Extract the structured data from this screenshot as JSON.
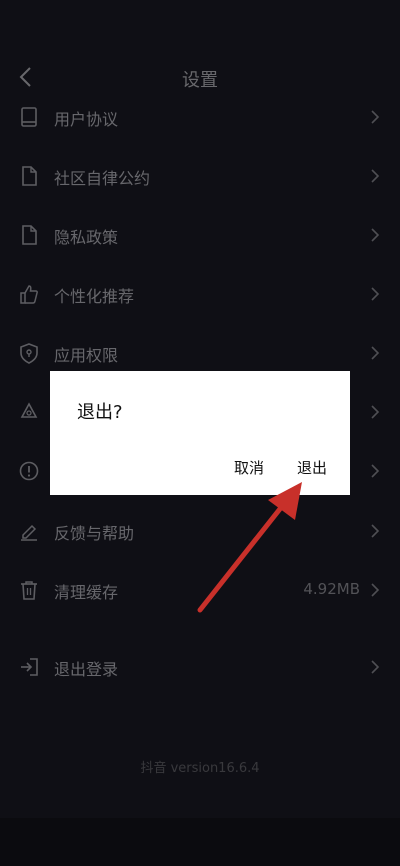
{
  "header": {
    "title": "设置"
  },
  "rows": [
    {
      "label": "用户协议",
      "icon": "book-icon"
    },
    {
      "label": "社区自律公约",
      "icon": "document-icon"
    },
    {
      "label": "隐私政策",
      "icon": "document-icon"
    },
    {
      "label": "个性化推荐",
      "icon": "thumbs-up-icon"
    },
    {
      "label": "应用权限",
      "icon": "shield-icon"
    },
    {
      "label": "",
      "icon": "recycle-icon"
    },
    {
      "label": "",
      "icon": "info-circle-icon"
    },
    {
      "label": "反馈与帮助",
      "icon": "edit-icon"
    },
    {
      "label": "清理缓存",
      "icon": "trash-icon",
      "value": "4.92MB"
    },
    {
      "label": "退出登录",
      "icon": "logout-icon"
    }
  ],
  "version": "抖音 version16.6.4",
  "dialog": {
    "title": "退出?",
    "cancel_label": "取消",
    "confirm_label": "退出"
  },
  "colors": {
    "background": "#15151c",
    "text": "#8a8a90",
    "dialog_bg": "#ffffff",
    "annotation_arrow": "#c8302a"
  }
}
